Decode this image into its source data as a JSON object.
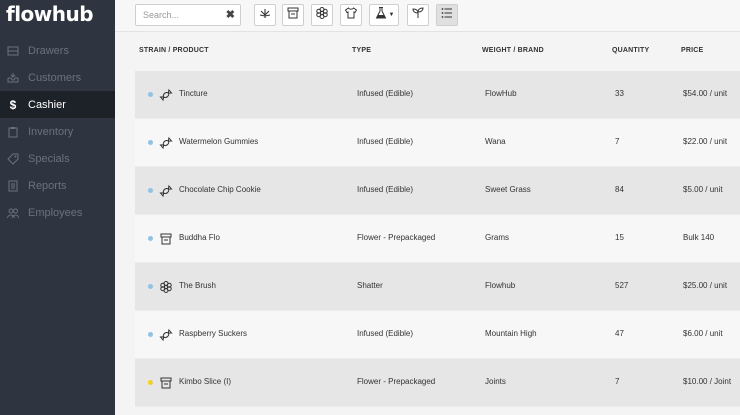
{
  "app": {
    "logo_text": "flowhub"
  },
  "sidebar": {
    "items": [
      {
        "label": "Drawers",
        "icon": "drawer-icon",
        "active": false
      },
      {
        "label": "Customers",
        "icon": "inbox-icon",
        "active": false
      },
      {
        "label": "Cashier",
        "icon": "dollar-icon",
        "active": true
      },
      {
        "label": "Inventory",
        "icon": "clipboard-icon",
        "active": false
      },
      {
        "label": "Specials",
        "icon": "tag-icon",
        "active": false
      },
      {
        "label": "Reports",
        "icon": "report-icon",
        "active": false
      },
      {
        "label": "Employees",
        "icon": "users-icon",
        "active": false
      }
    ]
  },
  "toolbar": {
    "search": {
      "value": "",
      "placeholder": "Search..."
    },
    "filters": [
      "cannabis-leaf-icon",
      "jar-icon",
      "flower-icon",
      "shirt-icon",
      "flask-icon",
      "sprout-icon",
      "list-view-icon"
    ]
  },
  "table": {
    "headers": {
      "name": "STRAIN / PRODUCT",
      "type": "TYPE",
      "brand": "WEIGHT / BRAND",
      "qty": "QUANTITY",
      "price": "PRICE"
    },
    "rows": [
      {
        "dot_color": "#8ec3e6",
        "icon": "candy-icon",
        "name": "Tincture",
        "type": "Infused (Edible)",
        "brand": "FlowHub",
        "qty": "33",
        "price": "$54.00 / unit"
      },
      {
        "dot_color": "#8ec3e6",
        "icon": "candy-icon",
        "name": "Watermelon Gummies",
        "type": "Infused (Edible)",
        "brand": "Wana",
        "qty": "7",
        "price": "$22.00 / unit"
      },
      {
        "dot_color": "#8ec3e6",
        "icon": "candy-icon",
        "name": "Chocolate Chip Cookie",
        "type": "Infused (Edible)",
        "brand": "Sweet Grass",
        "qty": "84",
        "price": "$5.00 / unit"
      },
      {
        "dot_color": "#8ec3e6",
        "icon": "jar-icon",
        "name": "Buddha Flo",
        "type": "Flower - Prepackaged",
        "brand": "Grams",
        "qty": "15",
        "price": "Bulk 140"
      },
      {
        "dot_color": "#8ec3e6",
        "icon": "flower-icon",
        "name": "The Brush",
        "type": "Shatter",
        "brand": "Flowhub",
        "qty": "527",
        "price": "$25.00 / unit"
      },
      {
        "dot_color": "#8ec3e6",
        "icon": "candy-icon",
        "name": "Raspberry Suckers",
        "type": "Infused (Edible)",
        "brand": "Mountain High",
        "qty": "47",
        "price": "$6.00 / unit"
      },
      {
        "dot_color": "#f2d21b",
        "icon": "jar-icon",
        "name": "Kimbo Slice (I)",
        "type": "Flower - Prepackaged",
        "brand": "Joints",
        "qty": "7",
        "price": "$10.00 / Joint"
      }
    ]
  }
}
